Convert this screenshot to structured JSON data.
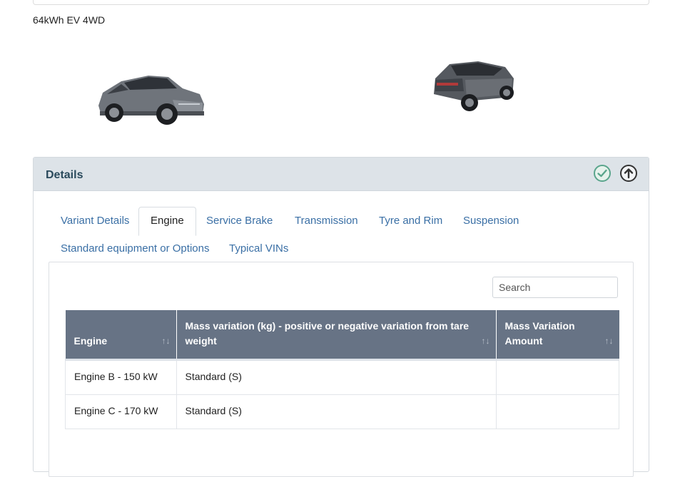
{
  "variant": {
    "label": "64kWh EV 4WD"
  },
  "details": {
    "title": "Details",
    "icons": {
      "status": "check-circle-icon",
      "collapse": "arrow-up-circle-icon"
    },
    "tabs": [
      {
        "label": "Variant Details",
        "active": false
      },
      {
        "label": "Engine",
        "active": true
      },
      {
        "label": "Service Brake",
        "active": false
      },
      {
        "label": "Transmission",
        "active": false
      },
      {
        "label": "Tyre and Rim",
        "active": false
      },
      {
        "label": "Suspension",
        "active": false
      },
      {
        "label": "Standard equipment or Options",
        "active": false
      },
      {
        "label": "Typical VINs",
        "active": false
      }
    ]
  },
  "search": {
    "placeholder": "Search",
    "value": ""
  },
  "table": {
    "columns": [
      "Engine",
      "Mass variation (kg) - positive or negative variation from tare weight",
      "Mass Variation Amount"
    ],
    "sort_icon": "sort-arrows-icon",
    "rows": [
      {
        "engine": "Engine B - 150 kW",
        "mass_variation": "Standard (S)",
        "amount": ""
      },
      {
        "engine": "Engine C - 170 kW",
        "mass_variation": "Standard (S)",
        "amount": ""
      }
    ]
  },
  "colors": {
    "header_bg": "#677385",
    "panel_header_bg": "#dde3e8",
    "link": "#3a6fa5",
    "check": "#5aa58c"
  }
}
